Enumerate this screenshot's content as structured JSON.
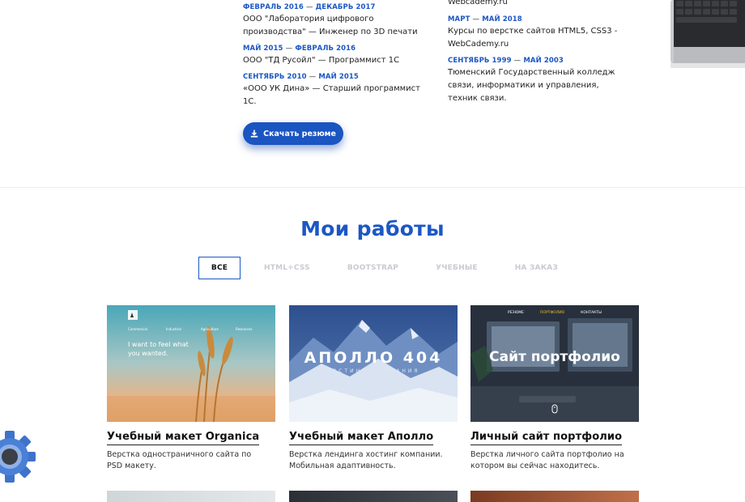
{
  "experience": [
    {
      "start": "ФЕВРАЛЬ 2016",
      "end": "ДЕКАБРЬ 2017",
      "text": "ООО \"Лаборатория цифрового производства\" — Инженер по 3D печати"
    },
    {
      "start": "МАЙ 2015",
      "end": "ФЕВРАЛЬ 2016",
      "text": "ООО \"ТД Русойл\" — Программист 1С"
    },
    {
      "start": "СЕНТЯБРЬ 2010",
      "end": "МАЙ 2015",
      "text": "«ООО УК Дина» — Старший программист 1С."
    }
  ],
  "education": {
    "top_text": "Webcademy.ru",
    "items": [
      {
        "start": "МАРТ",
        "end": "МАЙ 2018",
        "text": "Курсы по верстке сайтов HTML5, CSS3 - WebCademy.ru"
      },
      {
        "start": "СЕНТЯБРЬ 1999",
        "end": "МАЙ 2003",
        "text": "Тюменский Государственный колледж связи, информатики и управления, техник связи."
      }
    ]
  },
  "download_label": "Скачать резюме",
  "dash": "—",
  "works": {
    "title": "Мои работы",
    "filters": [
      "ВСЕ",
      "HTML+CSS",
      "BOOTSTRAP",
      "УЧЕБНЫЕ",
      "НА ЗАКАЗ"
    ],
    "cards": [
      {
        "title": "Учебный макет Organica",
        "desc": "Верстка одностраничного сайта по PSD макету.",
        "thumb_nav": [
          "Commercial",
          "Industrial",
          "Agriculture",
          "Resources"
        ],
        "thumb_text": "I want to feel what you wanted."
      },
      {
        "title": "Учебный макет Аполло",
        "desc": "Верстка лендинга хостинг компании. Мобильная адаптивность.",
        "thumb_title": "АПОЛЛО 404",
        "thumb_subtitle": "ХОСТИНГ КОМПАНИЯ"
      },
      {
        "title": "Личный сайт портфолио",
        "desc": "Верстка личного сайта портфолио на котором вы сейчас находитесь.",
        "thumb_nav": [
          "РЕЗЮМЕ",
          "ПОРТФОЛИО",
          "КОНТАКТЫ"
        ],
        "thumb_title": "Сайт портфолио"
      }
    ]
  },
  "colors": {
    "accent": "#1c57c4",
    "button": "#1a55c1"
  }
}
